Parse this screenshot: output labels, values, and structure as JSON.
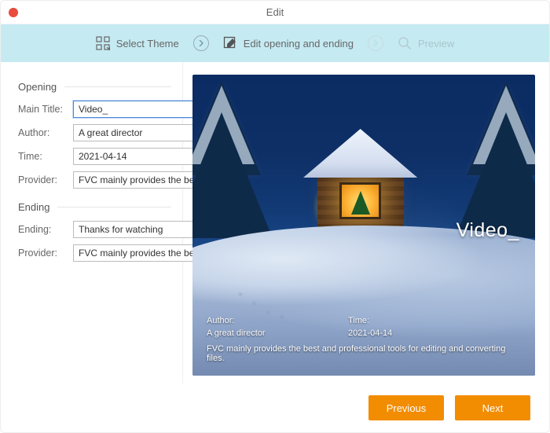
{
  "window": {
    "title": "Edit"
  },
  "steps": {
    "select_theme": "Select Theme",
    "edit_opening_ending": "Edit opening and ending",
    "preview": "Preview"
  },
  "sidebar": {
    "opening": {
      "heading": "Opening",
      "main_title_label": "Main Title:",
      "main_title_value": "Video_",
      "author_label": "Author:",
      "author_value": "A great director",
      "time_label": "Time:",
      "time_value": "2021-04-14",
      "provider_label": "Provider:",
      "provider_value": "FVC mainly provides the best a"
    },
    "ending": {
      "heading": "Ending",
      "ending_label": "Ending:",
      "ending_value": "Thanks for watching",
      "provider_label": "Provider:",
      "provider_value": "FVC mainly provides the best a"
    }
  },
  "preview": {
    "title": "Video_",
    "author_label": "Author:",
    "author_value": "A great director",
    "time_label": "Time:",
    "time_value": "2021-04-14",
    "provider_line": "FVC mainly provides the best and professional tools for editing and converting files."
  },
  "footer": {
    "previous": "Previous",
    "next": "Next"
  }
}
